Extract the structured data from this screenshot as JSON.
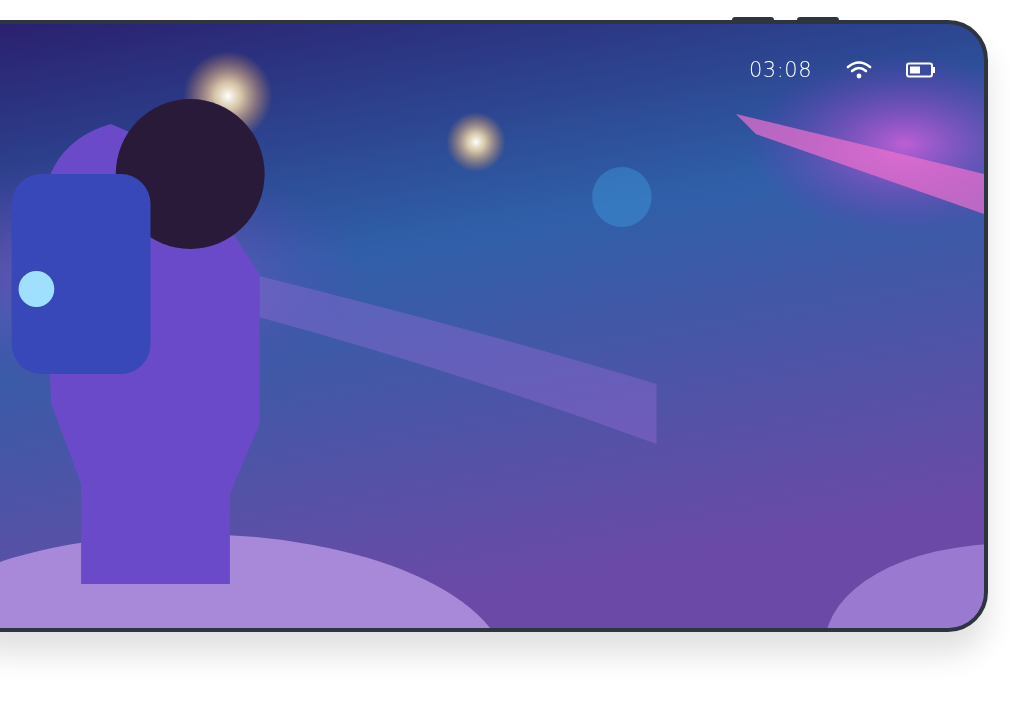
{
  "status_bar": {
    "time": "03:08"
  }
}
